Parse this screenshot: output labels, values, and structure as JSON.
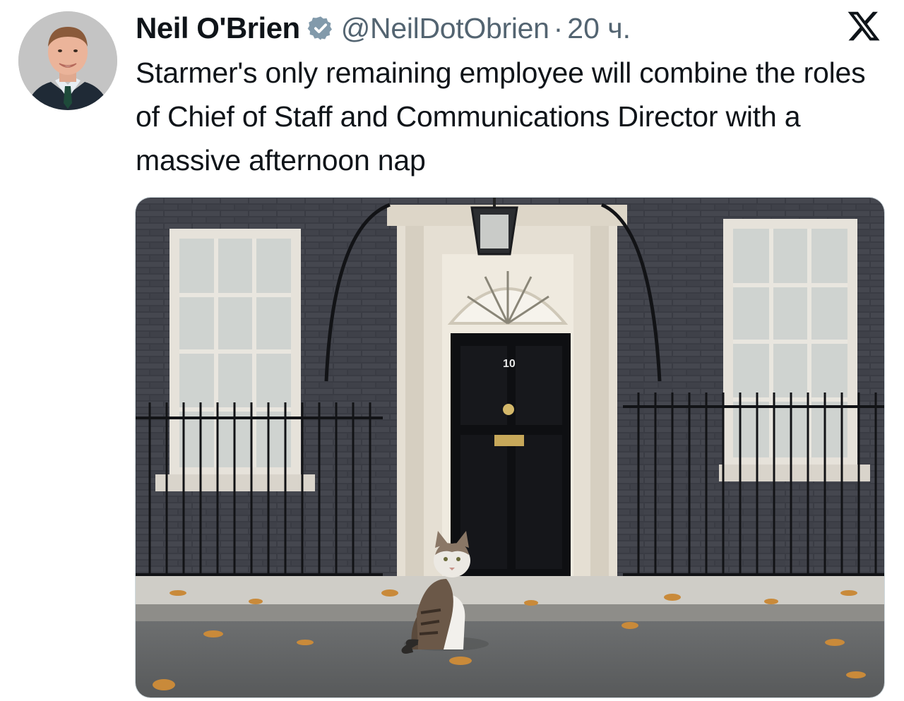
{
  "tweet": {
    "author_name": "Neil O'Brien",
    "handle": "@NeilDotObrien",
    "separator": "·",
    "time": "20 ч.",
    "text": "Starmer's only remaining employee will combine the roles of Chief of Staff and Communications Director with a massive afternoon nap",
    "verified": true,
    "door_number": "10"
  },
  "icons": {
    "verified": "verified-badge-icon",
    "brand": "x-logo-icon"
  },
  "colors": {
    "text_primary": "#0f1419",
    "text_secondary": "#536471",
    "verified_badge": "#829aab",
    "media_border": "#cfd9de"
  }
}
